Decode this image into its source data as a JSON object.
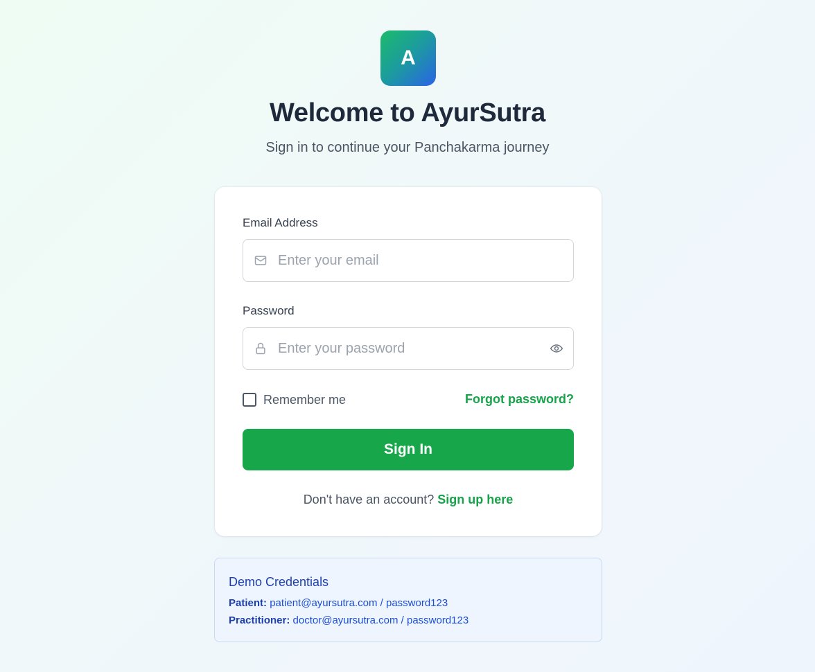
{
  "brand": {
    "logo_letter": "A",
    "title": "Welcome to AyurSutra",
    "subtitle": "Sign in to continue your Panchakarma journey",
    "accent_color": "#16a34a"
  },
  "form": {
    "email": {
      "label": "Email Address",
      "placeholder": "Enter your email",
      "value": "",
      "icon": "mail-icon"
    },
    "password": {
      "label": "Password",
      "placeholder": "Enter your password",
      "value": "",
      "icon": "lock-icon",
      "toggle_icon": "eye-icon"
    },
    "remember_label": "Remember me",
    "remember_checked": false,
    "forgot_label": "Forgot password?",
    "submit_label": "Sign In",
    "signup_prompt": "Don't have an account?",
    "signup_link": "Sign up here"
  },
  "demo": {
    "title": "Demo Credentials",
    "patient_label": "Patient:",
    "patient_value": "patient@ayursutra.com / password123",
    "practitioner_label": "Practitioner:",
    "practitioner_value": "doctor@ayursutra.com / password123"
  }
}
